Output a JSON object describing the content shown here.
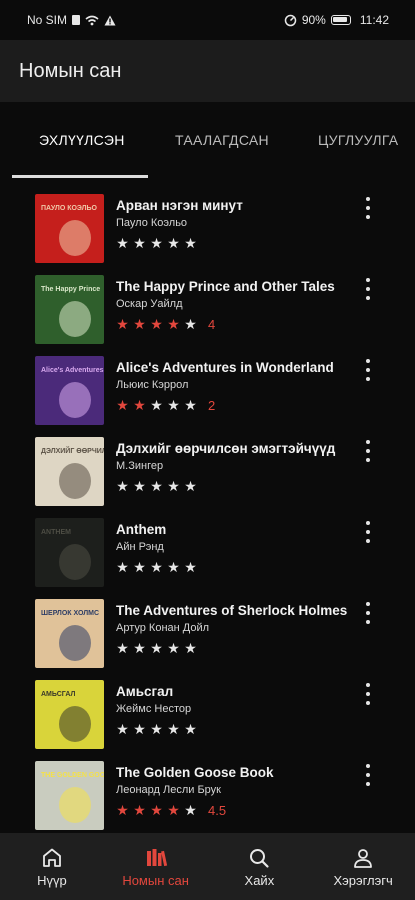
{
  "status_bar": {
    "carrier": "No SIM",
    "battery": "90%",
    "time": "11:42"
  },
  "appbar": {
    "title": "Номын сан"
  },
  "tabs": [
    {
      "label": "ЭХЛҮҮЛСЭН",
      "active": true
    },
    {
      "label": "ТААЛАГДСАН",
      "active": false
    },
    {
      "label": "ЦУГЛУУЛГА",
      "active": false
    }
  ],
  "books": [
    {
      "title": "Арван нэгэн минут",
      "author": "Пауло Коэльо",
      "stars": 0,
      "rating": ""
    },
    {
      "title": "The Happy Prince and Other Tales",
      "author": "Оскар Уайлд",
      "stars": 4,
      "rating": "4"
    },
    {
      "title": "Alice's Adventures in Wonderland",
      "author": "Льюис Кэррол",
      "stars": 2,
      "rating": "2"
    },
    {
      "title": "Дэлхийг өөрчилсөн эмэгтэйчүүд",
      "author": "М.Зингер",
      "stars": 0,
      "rating": ""
    },
    {
      "title": "Anthem",
      "author": "Айн Рэнд",
      "stars": 0,
      "rating": ""
    },
    {
      "title": "The Adventures of Sherlock Holmes",
      "author": "Артур Конан Дойл",
      "stars": 0,
      "rating": ""
    },
    {
      "title": "Амьсгал",
      "author": "Жеймс Нестор",
      "stars": 0,
      "rating": ""
    },
    {
      "title": "The Golden Goose Book",
      "author": "Леонард Лесли Брук",
      "stars": 4.5,
      "rating": "4.5"
    }
  ],
  "covers": [
    {
      "bg": "#c51f1c",
      "fg": "#f0c8a8",
      "caption": "ПАУЛО КОЭЛЬО"
    },
    {
      "bg": "#2f5f2c",
      "fg": "#d9e7c9",
      "caption": "The Happy Prince"
    },
    {
      "bg": "#4b2a7a",
      "fg": "#d8a9ef",
      "caption": "Alice's Adventures in Wonderland"
    },
    {
      "bg": "#ded6c4",
      "fg": "#5a5145",
      "caption": "ДЭЛХИЙГ ӨӨРЧИЛСӨН"
    },
    {
      "bg": "#1d1f1c",
      "fg": "#4d4d44",
      "caption": "ANTHEM"
    },
    {
      "bg": "#e0c299",
      "fg": "#2e3e66",
      "caption": "ШЕРЛОК ХОЛМС"
    },
    {
      "bg": "#d9d43a",
      "fg": "#3a3a2a",
      "caption": "АМЬСГАЛ"
    },
    {
      "bg": "#c9ccbf",
      "fg": "#f4e14a",
      "caption": "THE GOLDEN GOOSE"
    }
  ],
  "bottom_nav": [
    {
      "label": "Нүүр",
      "icon": "home-icon",
      "active": false
    },
    {
      "label": "Номын сан",
      "icon": "library-icon",
      "active": true
    },
    {
      "label": "Хайх",
      "icon": "search-icon",
      "active": false
    },
    {
      "label": "Хэрэглэгч",
      "icon": "user-icon",
      "active": false
    }
  ],
  "colors": {
    "accent": "#e2473d",
    "background": "#0b0b0b",
    "appbar": "#1c1c1c",
    "bottom_nav": "#1f1f1f"
  }
}
